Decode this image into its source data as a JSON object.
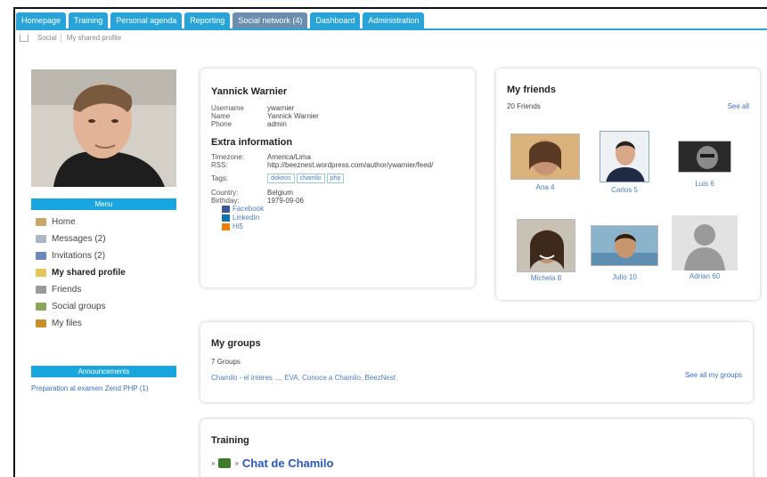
{
  "tabs": [
    "Homepage",
    "Training",
    "Personal agenda",
    "Reporting",
    "Social network (4)",
    "Dashboard",
    "Administration"
  ],
  "active_tab": 4,
  "breadcrumb": [
    "Social",
    "My shared profile"
  ],
  "sidebar": {
    "menu_title": "Menu",
    "items": [
      {
        "label": "Home",
        "icon": "home-icon",
        "color": "#c8a86a"
      },
      {
        "label": "Messages (2)",
        "icon": "messages-icon",
        "color": "#aab7c8"
      },
      {
        "label": "Invitations (2)",
        "icon": "invitations-icon",
        "color": "#6b88b8"
      },
      {
        "label": "My shared profile",
        "icon": "folder-icon",
        "color": "#e5c45a"
      },
      {
        "label": "Friends",
        "icon": "friends-icon",
        "color": "#9a9a9a"
      },
      {
        "label": "Social groups",
        "icon": "groups-icon",
        "color": "#8aa65a"
      },
      {
        "label": "My files",
        "icon": "files-icon",
        "color": "#c9902a"
      }
    ],
    "announcements_title": "Announcements",
    "announcement_link": "Preparation al examen Zend PHP (1)"
  },
  "profile": {
    "name": "Yannick Warnier",
    "username_label": "Username",
    "username": "ywarnier",
    "name_label": "Name",
    "name_value": "Yannick Warnier",
    "phone_label": "Phone",
    "phone": "admin",
    "extra_title": "Extra information",
    "timezone_label": "Timezone:",
    "timezone": "America/Lima",
    "rss_label": "RSS:",
    "rss": "http://beeznest.wordpress.com/author/ywarnier/feed/",
    "tags_label": "Tags:",
    "tags": [
      "dokeos",
      "chamilo",
      "php"
    ],
    "country_label": "Country:",
    "country": "Belgium",
    "birthday_label": "Birthday:",
    "birthday": "1979-09-06",
    "social": [
      {
        "label": "Facebook",
        "icon": "facebook-icon",
        "color": "#3b5998"
      },
      {
        "label": "LinkedIn",
        "icon": "linkedin-icon",
        "color": "#0e76a8"
      },
      {
        "label": "Hi5",
        "icon": "hi5-icon",
        "color": "#ef7d00"
      }
    ]
  },
  "friends": {
    "title": "My friends",
    "count": "20 Friends",
    "see_all": "See all",
    "list": [
      "Ana 4",
      "Carlos 5",
      "Luis 6",
      "Michela 8",
      "Julio 10",
      "Adrian 60"
    ]
  },
  "groups": {
    "title": "My groups",
    "count": "7 Groups",
    "links": "Chamilo - el interes ..., EVA, Conoce a Chamilo, BeezNest",
    "see_all": "See all my groups"
  },
  "training": {
    "title": "Training",
    "course": "Chat de Chamilo"
  },
  "colors": {
    "tab": "#28a4d8",
    "tab_active": "#6a8fae",
    "menu_header": "#19a6de",
    "link": "#4a7fbf"
  }
}
